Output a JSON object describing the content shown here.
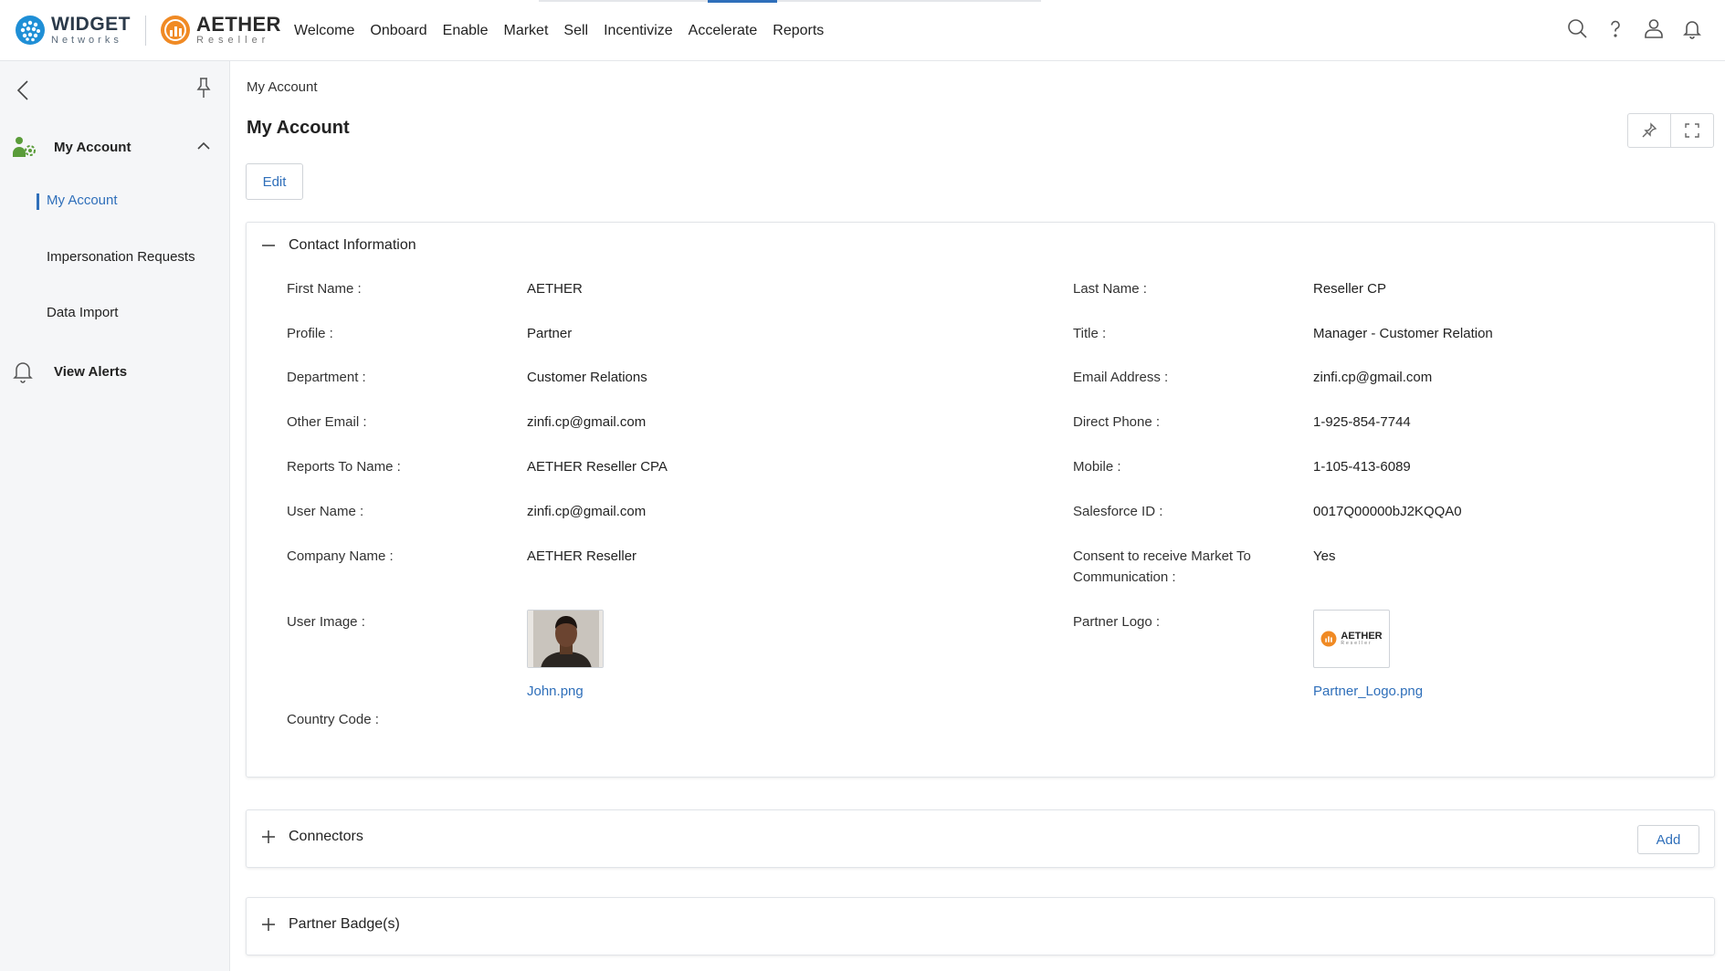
{
  "header": {
    "brand_widget": {
      "title": "WIDGET",
      "subtitle": "Networks"
    },
    "brand_aether": {
      "title": "AETHER",
      "subtitle": "Reseller"
    },
    "nav": [
      "Welcome",
      "Onboard",
      "Enable",
      "Market",
      "Sell",
      "Incentivize",
      "Accelerate",
      "Reports"
    ],
    "icons": [
      "search-icon",
      "help-icon",
      "user-icon",
      "bell-icon"
    ]
  },
  "sidebar": {
    "section_label": "My Account",
    "items": [
      "My Account",
      "Impersonation Requests",
      "Data Import"
    ],
    "active_item": "My Account",
    "alerts_label": "View Alerts"
  },
  "main": {
    "breadcrumb": "My Account",
    "title": "My Account",
    "edit_label": "Edit",
    "contact": {
      "title": "Contact Information",
      "left": [
        {
          "label": "First Name :",
          "value": "AETHER"
        },
        {
          "label": "Profile :",
          "value": "Partner"
        },
        {
          "label": "Department :",
          "value": "Customer Relations"
        },
        {
          "label": "Other Email :",
          "value": "zinfi.cp@gmail.com"
        },
        {
          "label": "Reports To Name :",
          "value": "AETHER Reseller CPA"
        },
        {
          "label": "User Name :",
          "value": "zinfi.cp@gmail.com"
        },
        {
          "label": "Company Name :",
          "value": "AETHER Reseller"
        }
      ],
      "right": [
        {
          "label": "Last Name :",
          "value": "Reseller CP"
        },
        {
          "label": "Title :",
          "value": "Manager - Customer Relation"
        },
        {
          "label": "Email Address :",
          "value": "zinfi.cp@gmail.com"
        },
        {
          "label": "Direct Phone :",
          "value": "1-925-854-7744"
        },
        {
          "label": "Mobile :",
          "value": "1-105-413-6089"
        },
        {
          "label": "Salesforce ID :",
          "value": "0017Q00000bJ2KQQA0"
        },
        {
          "label": "Consent to receive Market To Communication :",
          "value": "Yes"
        }
      ],
      "user_image_label": "User Image :",
      "user_image_file": "John.png",
      "partner_logo_label": "Partner Logo :",
      "partner_logo_file": "Partner_Logo.png",
      "partner_logo_text": "AETHER",
      "partner_logo_subtext": "Reseller",
      "country_code_label": "Country Code :"
    },
    "connectors": {
      "title": "Connectors",
      "add_label": "Add"
    },
    "badges": {
      "title": "Partner Badge(s)"
    }
  },
  "colors": {
    "accent": "#2f6fba",
    "brand_orange": "#f08a24",
    "widget_blue": "#1f8fd6"
  }
}
